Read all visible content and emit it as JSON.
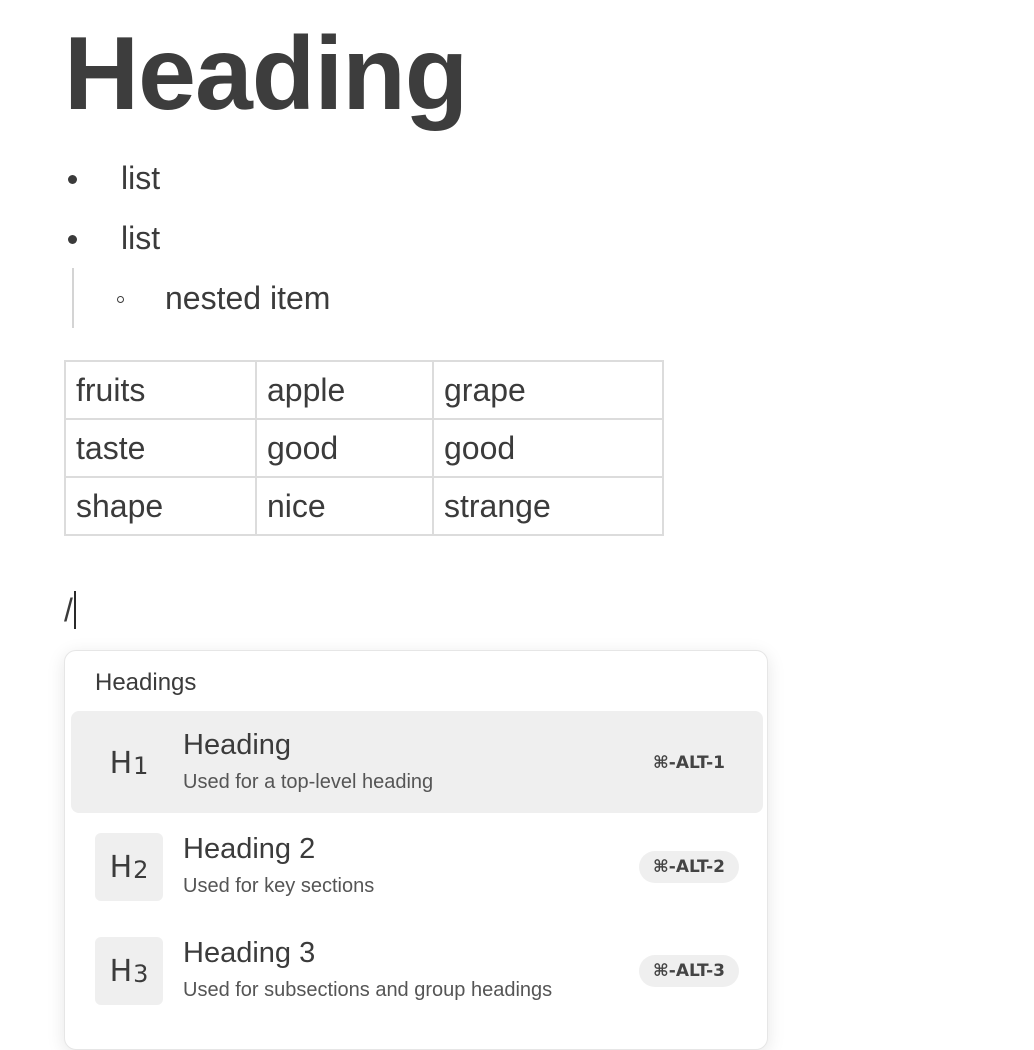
{
  "document": {
    "heading": "Heading",
    "list_items": [
      "list",
      "list"
    ],
    "nested_item": "nested item",
    "table": [
      [
        "fruits",
        "apple",
        "grape"
      ],
      [
        "taste",
        "good",
        "good"
      ],
      [
        "shape",
        "nice",
        "strange"
      ]
    ],
    "slash_input": "/"
  },
  "slash_menu": {
    "section_title": "Headings",
    "selected_index": 0,
    "items": [
      {
        "icon_letter": "H",
        "icon_number": "1",
        "icon": "heading-1-icon",
        "title": "Heading",
        "description": "Used for a top-level heading",
        "shortcut": "⌘-ALT-1"
      },
      {
        "icon_letter": "H",
        "icon_number": "2",
        "icon": "heading-2-icon",
        "title": "Heading 2",
        "description": "Used for key sections",
        "shortcut": "⌘-ALT-2"
      },
      {
        "icon_letter": "H",
        "icon_number": "3",
        "icon": "heading-3-icon",
        "title": "Heading 3",
        "description": "Used for subsections and group headings",
        "shortcut": "⌘-ALT-3"
      }
    ]
  }
}
